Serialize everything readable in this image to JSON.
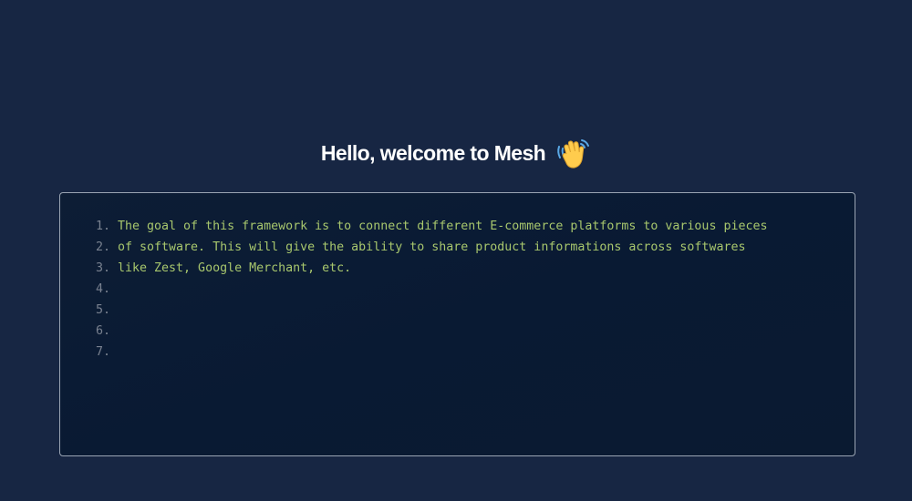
{
  "header": {
    "title": "Hello, welcome to Mesh",
    "emoji_icon": "waving-hand-icon"
  },
  "editor": {
    "lines": [
      {
        "number": "1.",
        "text": "The goal of this framework is to connect different E-commerce platforms to various pieces"
      },
      {
        "number": "2.",
        "text": "of software. This will give the ability to share product informations across softwares"
      },
      {
        "number": "3.",
        "text": "like Zest, Google Merchant, etc."
      },
      {
        "number": "4.",
        "text": ""
      },
      {
        "number": "5.",
        "text": ""
      },
      {
        "number": "6.",
        "text": ""
      },
      {
        "number": "7.",
        "text": ""
      }
    ]
  },
  "colors": {
    "background": "#172643",
    "editor_border": "#9aa4b3",
    "code_text": "#a8c76d",
    "line_number": "#7a8290",
    "title_text": "#ffffff"
  }
}
